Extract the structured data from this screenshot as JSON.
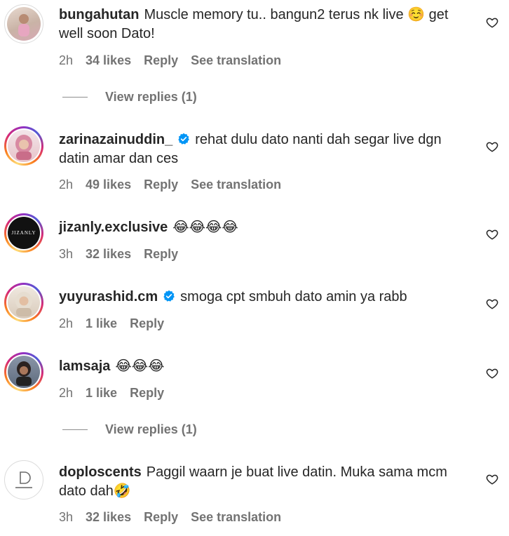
{
  "comments": [
    {
      "username": "bungahutan",
      "verified": false,
      "text": "Muscle memory tu.. bangun2 terus nk live ☺️ get well soon Dato!",
      "time": "2h",
      "likes": "34 likes",
      "reply": "Reply",
      "translate": "See translation",
      "avatar": "photo-child"
    },
    {
      "username": "zarinazainuddin_",
      "verified": true,
      "text": "rehat dulu dato nanti dah segar live dgn datin amar dan ces",
      "time": "2h",
      "likes": "49 likes",
      "reply": "Reply",
      "translate": "See translation",
      "avatar": "photo-woman-hijab"
    },
    {
      "username": "jizanly.exclusive",
      "verified": false,
      "text": "😂😂😂😂",
      "time": "3h",
      "likes": "32 likes",
      "reply": "Reply",
      "avatar": "logo-jizanly",
      "avatar_logo_text": "JIZANLY"
    },
    {
      "username": "yuyurashid.cm",
      "verified": true,
      "text": "smoga cpt smbuh dato amin ya rabb",
      "time": "2h",
      "likes": "1 like",
      "reply": "Reply",
      "avatar": "photo-woman-hijab-light"
    },
    {
      "username": "lamsaja",
      "verified": false,
      "text": "😂😂😂",
      "time": "2h",
      "likes": "1 like",
      "reply": "Reply",
      "avatar": "photo-woman"
    },
    {
      "username": "doploscents",
      "verified": false,
      "text": "Paggil waarn je buat live datin. Muka sama mcm dato dah🤣",
      "time": "3h",
      "likes": "32 likes",
      "reply": "Reply",
      "translate": "See translation",
      "avatar": "logo-doploscents"
    }
  ],
  "view_replies": "View replies (1)",
  "colors": {
    "text": "#262626",
    "muted": "#737373",
    "verified": "#0095f6",
    "ring_start": "#feda75",
    "ring_end": "#962fbf"
  }
}
